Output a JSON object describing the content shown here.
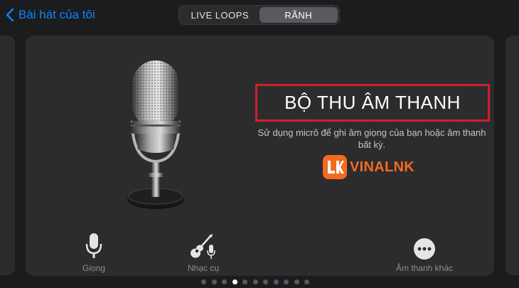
{
  "nav": {
    "back_label": "Bài hát của tôi"
  },
  "segments": {
    "items": [
      {
        "label": "LIVE LOOPS",
        "active": false
      },
      {
        "label": "RÃNH",
        "active": true
      }
    ]
  },
  "card": {
    "title": "BỘ THU ÂM THANH",
    "description": "Sử dụng micrô để ghi âm giọng của bạn hoặc âm thanh bất kỳ.",
    "brand_name": "VINALNK",
    "brand_logo_text": "LK",
    "brand_color": "#f26b21",
    "highlight_color": "#d0202b"
  },
  "options": {
    "voice": {
      "label": "Giọng",
      "icon": "microphone-icon"
    },
    "instrument": {
      "label": "Nhạc cụ",
      "icon": "guitar-mic-icon"
    },
    "other": {
      "label": "Âm thanh khác",
      "icon": "more-dots-icon"
    }
  },
  "pager": {
    "count": 11,
    "active_index": 3
  },
  "colors": {
    "accent": "#0a84ff",
    "background": "#1c1c1e",
    "card": "#2c2c2e"
  }
}
